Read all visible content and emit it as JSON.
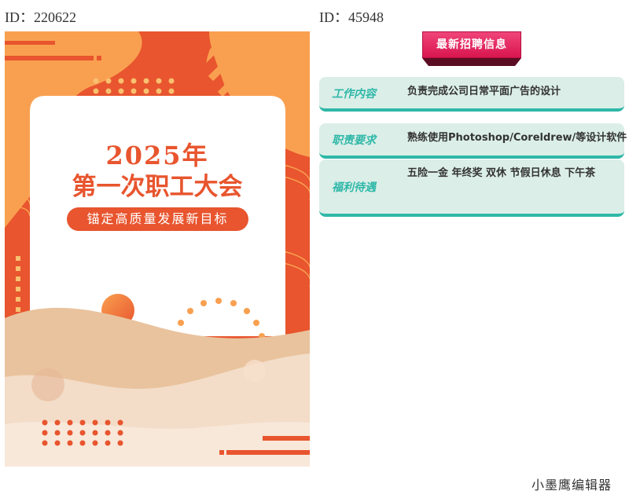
{
  "left_id": "ID：220622",
  "right_id": "ID：45948",
  "poster": {
    "year": "2025年",
    "title": "第一次职工大会",
    "slogan": "锚定高质量发展新目标"
  },
  "recruit": {
    "banner": "最新招聘信息",
    "rows": [
      {
        "key": "工作内容",
        "value": "负责完成公司日常平面广告的设计"
      },
      {
        "key": "职责要求",
        "value": "熟练使用Photoshop/Coreldrew/等设计软件"
      },
      {
        "key": "福利待遇",
        "value": "五险一金 年终奖  双休  节假日休息  下午茶"
      }
    ]
  },
  "footer": "小墨鹰编辑器",
  "colors": {
    "poster_orange": "#e8552e",
    "poster_light_orange": "#f9a050",
    "teal": "#2fb8a8",
    "row_bg": "#dbeee8",
    "banner_pink": "#e0245c"
  }
}
